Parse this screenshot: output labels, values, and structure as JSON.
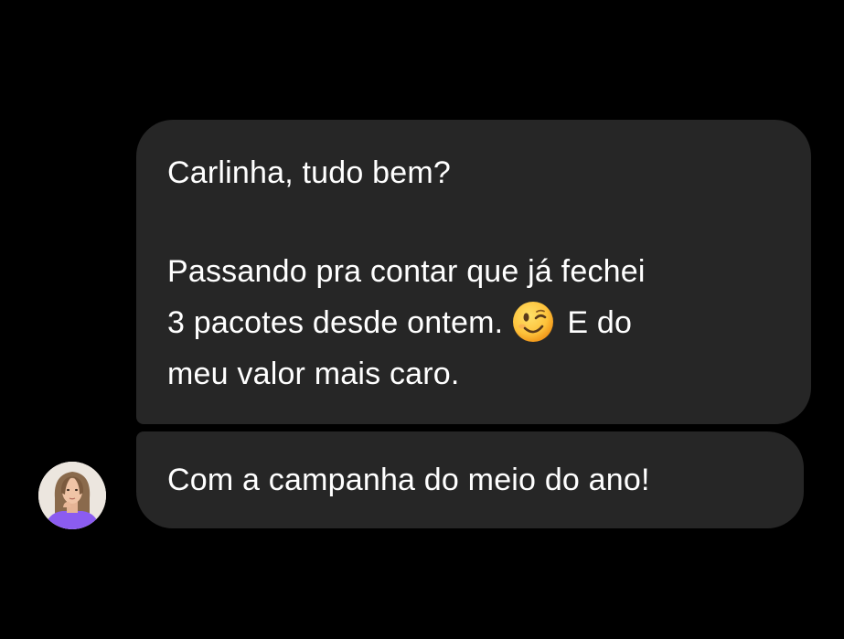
{
  "conversation": {
    "messages": [
      {
        "lines": [
          "Carlinha, tudo bem?",
          "",
          "Passando pra contar que já fechei",
          "3 pacotes desde ontem.",
          "E do",
          "meu valor mais caro."
        ],
        "emoji": "winking-face"
      },
      {
        "text": "Com a campanha do meio do ano!"
      }
    ],
    "sender": {
      "avatar": "profile-photo"
    }
  },
  "colors": {
    "background": "#000000",
    "bubble": "#262626",
    "text": "#ffffff"
  }
}
